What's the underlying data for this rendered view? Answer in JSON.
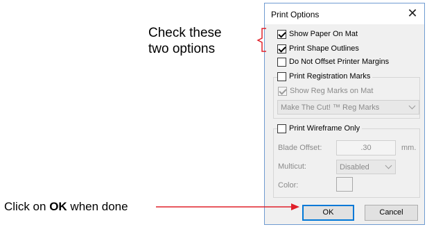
{
  "annotations": {
    "check_line1": "Check these",
    "check_line2": "two options",
    "ok_prefix": "Click on ",
    "ok_bold": "OK",
    "ok_suffix": " when done"
  },
  "dialog": {
    "title": "Print Options",
    "close_glyph": "✕",
    "show_paper_on_mat": {
      "label": "Show Paper On Mat",
      "checked": true
    },
    "print_shape_outlines": {
      "label": "Print Shape Outlines",
      "checked": true
    },
    "do_not_offset_margins": {
      "label": "Do Not Offset Printer Margins",
      "checked": false
    },
    "registration_group": {
      "label": "Print Registration Marks",
      "checked": false,
      "show_reg_marks": {
        "label": "Show Reg Marks on Mat",
        "checked": true,
        "disabled": true
      },
      "reg_marks_select": "Make The Cut! ™ Reg Marks"
    },
    "wireframe_group": {
      "label": "Print Wireframe Only",
      "checked": false,
      "blade_offset_label": "Blade Offset:",
      "blade_offset_value": ".30",
      "blade_offset_unit": "mm.",
      "multicut_label": "Multicut:",
      "multicut_value": "Disabled",
      "color_label": "Color:"
    },
    "ok_label": "OK",
    "cancel_label": "Cancel"
  },
  "colors": {
    "annotation_arrow": "#e0202a",
    "dialog_border": "#6e9bd1",
    "default_button_border": "#0078d7"
  }
}
